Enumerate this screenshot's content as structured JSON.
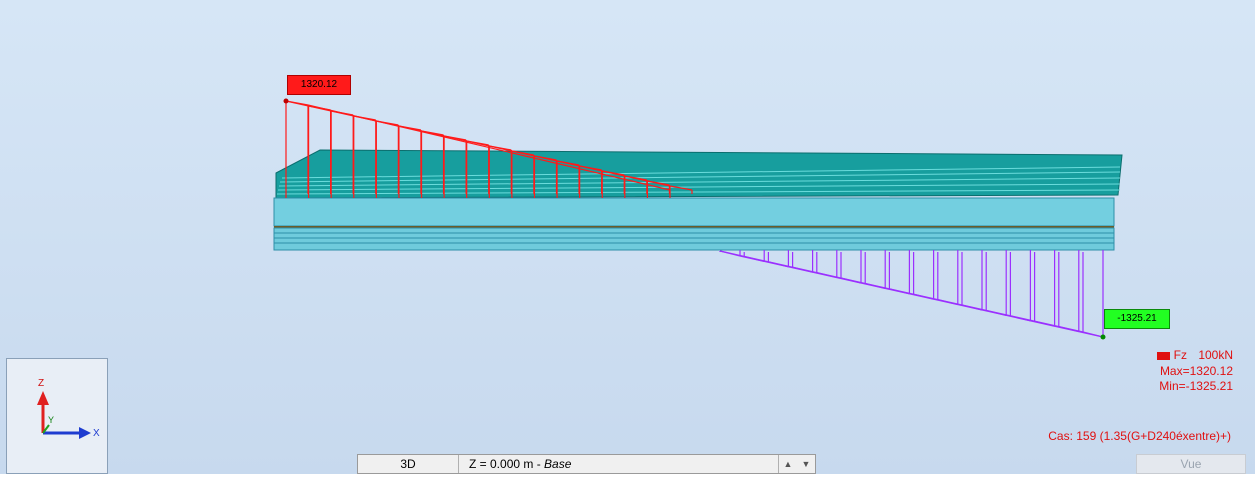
{
  "diagram": {
    "max_label": "1320.12",
    "min_label": "-1325.21"
  },
  "legend": {
    "quantity": "Fz",
    "unit": "100kN",
    "max": "Max=1320.12",
    "min": "Min=-1325.21"
  },
  "case_text": "Cas: 159 (1.35(G+D240éxentre)+)",
  "axes": {
    "z": "Z",
    "y": "Y",
    "x": "X"
  },
  "toolbar": {
    "view_mode": "3D",
    "z_prefix": "Z = 0.000 m - ",
    "z_name": "Base",
    "up_arrow": "▲",
    "down_arrow": "▼",
    "vue_label": "Vue"
  },
  "colors": {
    "positive": "#ff1a1a",
    "negative": "#9b30ff",
    "beam_top": "#17a3a3",
    "beam_side": "#6fcfde"
  }
}
